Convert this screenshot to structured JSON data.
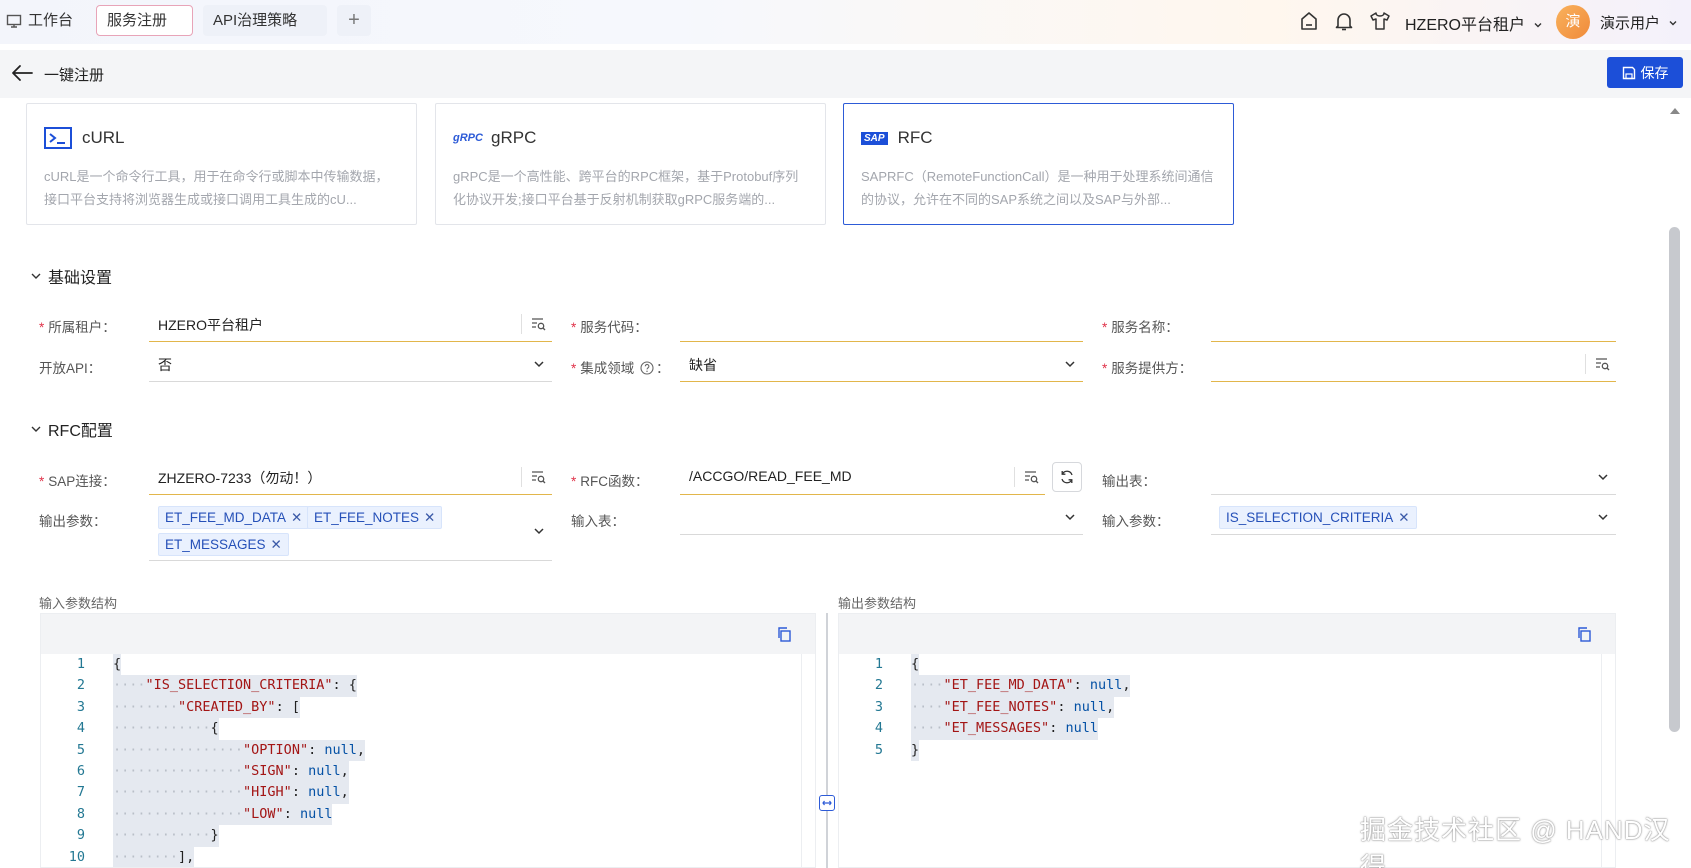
{
  "tabs": {
    "workbench": "工作台",
    "register": "服务注册",
    "api_policy": "API治理策略",
    "add": "+"
  },
  "header": {
    "tenant": "HZERO平台租户",
    "avatar_char": "演",
    "user": "演示用户"
  },
  "page": {
    "title": "一键注册",
    "save": "保存"
  },
  "cards": [
    {
      "title": "cURL",
      "desc": "cURL是一个命令行工具，用于在命令行或脚本中传输数据，接口平台支持将浏览器生成或接口调用工具生成的cU..."
    },
    {
      "title": "gRPC",
      "icon_text": "gRPC",
      "desc": "gRPC是一个高性能、跨平台的RPC框架，基于Protobuf序列化协议开发;接口平台基于反射机制获取gRPC服务端的..."
    },
    {
      "title": "RFC",
      "icon_text": "SAP",
      "desc": "SAPRFC（RemoteFunctionCall）是一种用于处理系统间通信的协议，允许在不同的SAP系统之间以及SAP与外部..."
    }
  ],
  "basic": {
    "title": "基础设置",
    "tenant_label": "所属租户",
    "tenant_value": "HZERO平台租户",
    "code_label": "服务代码",
    "code_value": "",
    "name_label": "服务名称",
    "name_value": "",
    "open_api_label": "开放API",
    "open_api_value": "否",
    "domain_label": "集成领域",
    "domain_value": "缺省",
    "provider_label": "服务提供方",
    "provider_value": ""
  },
  "rfc": {
    "title": "RFC配置",
    "sap_label": "SAP连接",
    "sap_value": "ZHZERO-7233（勿动！）",
    "func_label": "RFC函数",
    "func_value": "/ACCGO/READ_FEE_MD",
    "out_table_label": "输出表",
    "out_params_label": "输出参数",
    "out_params": [
      "ET_FEE_MD_DATA",
      "ET_FEE_NOTES",
      "ET_MESSAGES"
    ],
    "in_table_label": "输入表",
    "in_params_label": "输入参数",
    "in_params": [
      "IS_SELECTION_CRITERIA"
    ],
    "colon": "："
  },
  "editors": {
    "input_label": "输入参数结构",
    "output_label": "输出参数结构"
  },
  "watermark": "掘金技术社区 @ HAND汉得"
}
